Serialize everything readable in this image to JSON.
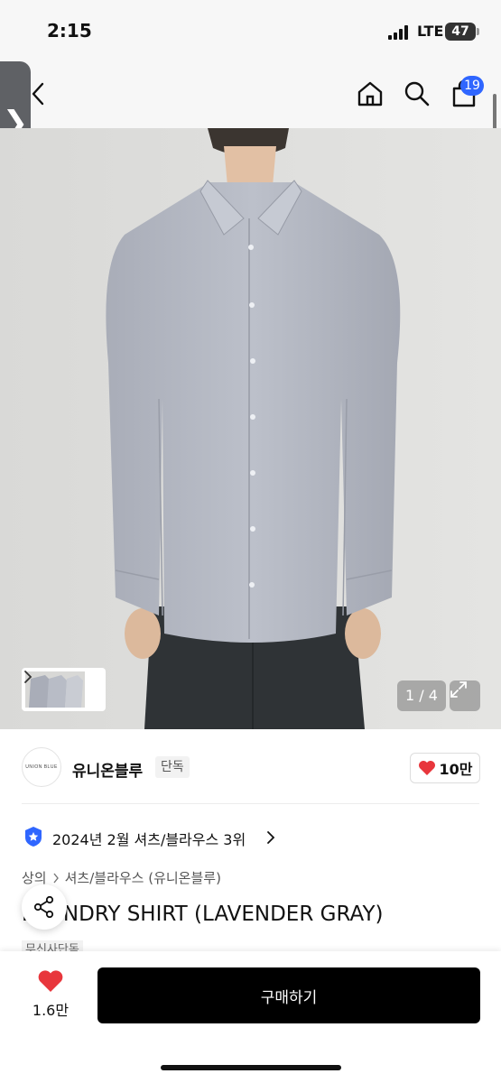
{
  "status_bar": {
    "time": "2:15",
    "network": "LTE",
    "battery": "47"
  },
  "header": {
    "cart_count": "19",
    "side_handle": "❯"
  },
  "gallery": {
    "page_counter": "1 / 4"
  },
  "brand": {
    "logo_text": "UNION BLUE",
    "name": "유니온블루",
    "tag": "단독",
    "likes": "10만"
  },
  "ranking": {
    "text": "2024년 2월 셔츠/블라우스 3위"
  },
  "breadcrumb": {
    "category": "상의",
    "subcategory": "셔츠/블라우스 (유니온블루)"
  },
  "product": {
    "title": "LAUNDRY SHIRT (LAVENDER GRAY)",
    "store_tag": "무신사단독"
  },
  "bottom_bar": {
    "likes": "1.6만",
    "buy_label": "구매하기"
  },
  "colors": {
    "accent_badge": "#2f66ff",
    "heart": "#e8363c",
    "buy_button": "#000000",
    "shirt": "#b4b8c2"
  }
}
